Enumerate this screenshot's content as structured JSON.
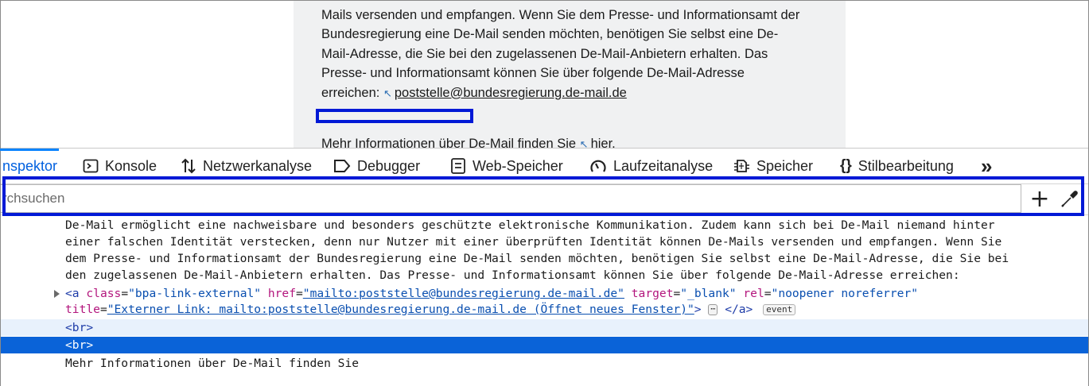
{
  "page": {
    "paragraph_lines": [
      "Mails versenden und empfangen. Wenn Sie dem Presse- und Informationsamt der",
      "Bundesregierung eine De-Mail senden möchten, benötigen Sie selbst eine De-",
      "Mail-Adresse, die Sie bei den zugelassenen De-Mail-Anbietern erhalten. Das",
      "Presse- und Informationsamt können Sie über folgende De-Mail-Adresse"
    ],
    "reach_prefix": "erreichen: ",
    "email_link": "poststelle@bundesregierung.de-mail.de",
    "external_arrow": "↖",
    "more_prefix": "Mehr Informationen über De-Mail finden Sie ",
    "more_link": "hier."
  },
  "devtools": {
    "tabs": [
      {
        "label": "nspektor",
        "icon": "inspector-icon"
      },
      {
        "label": "Konsole",
        "icon": "console-icon"
      },
      {
        "label": "Netzwerkanalyse",
        "icon": "network-icon"
      },
      {
        "label": "Debugger",
        "icon": "debugger-icon"
      },
      {
        "label": "Web-Speicher",
        "icon": "storage-icon"
      },
      {
        "label": "Laufzeitanalyse",
        "icon": "performance-icon"
      },
      {
        "label": "Speicher",
        "icon": "memory-icon"
      },
      {
        "label": "Stilbearbeitung",
        "icon": "style-editor-icon"
      }
    ],
    "overflow_glyph": "»",
    "search_placeholder": "rchsuchen",
    "add_node_glyph": "+",
    "markup": {
      "text_lines": [
        "De-Mail ermöglicht eine nachweisbare und besonders geschützte elektronische Kommunikation. Zudem kann sich bei De-Mail niemand hinter",
        "einer falschen Identität verstecken, denn nur Nutzer mit einer überprüften Identität können De-Mails versenden und empfangen. Wenn Sie",
        "dem Presse- und Informationsamt der Bundesregierung eine De-Mail senden möchten, benötigen Sie selbst eine De-Mail-Adresse, die Sie bei",
        "den zugelassenen De-Mail-Anbietern erhalten. Das Presse- und Informationsamt können Sie über folgende De-Mail-Adresse erreichen:"
      ],
      "a_tag_open": "<a",
      "a_class_name": "class",
      "a_class_value": "\"bpa-link-external\"",
      "a_href_name": "href",
      "a_href_value": "\"mailto:poststelle@bundesregierung.de-mail.de\"",
      "a_target_name": "target",
      "a_target_value": "\"_blank\"",
      "a_rel_name": "rel",
      "a_rel_value": "\"noopener noreferrer\"",
      "a_title_name": "title",
      "a_title_value": "\"Externer Link: mailto:poststelle@bundesregierung.de-mail.de (Öffnet neues Fenster)\"",
      "a_tag_close_open": ">",
      "ellipsis": "⋯",
      "a_tag_end": "</a>",
      "event_badge": "event",
      "br1": "<br>",
      "br2": "<br>",
      "last_text": "Mehr Informationen über De-Mail finden Sie"
    }
  }
}
